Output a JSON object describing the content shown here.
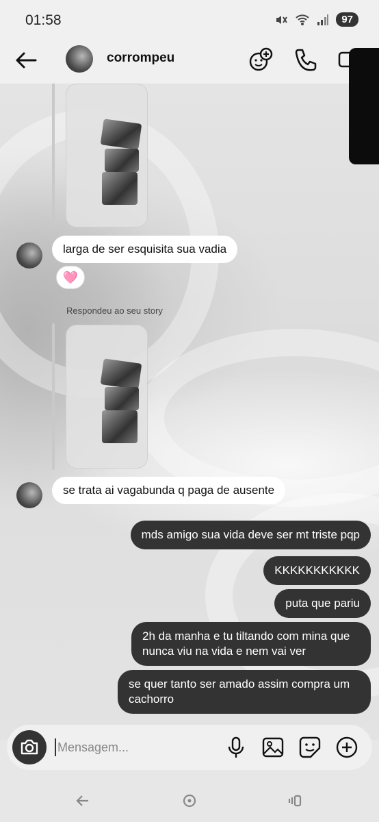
{
  "status_bar": {
    "time": "01:58",
    "battery": "97",
    "icons": [
      "mute-icon",
      "wifi-icon",
      "signal-icon"
    ]
  },
  "header": {
    "contact_name": "corrompeu",
    "icons": [
      "back-arrow-icon",
      "face-add-icon",
      "phone-icon",
      "video-icon"
    ]
  },
  "messages": {
    "incoming_1": "larga de ser esquisita sua vadia",
    "reaction_1": "🩷",
    "reply_caption": "Respondeu ao seu story",
    "incoming_2": "se trata ai vagabunda q paga de ausente",
    "outgoing": [
      "mds amigo sua vida deve ser mt triste pqp",
      "KKKKKKKKKKK",
      "puta que pariu",
      "2h da manha e tu tiltando com mina que nunca viu na vida e nem vai ver",
      "se quer tanto ser amado assim compra um cachorro"
    ]
  },
  "composer": {
    "placeholder": "Mensagem...",
    "icons": [
      "camera-icon",
      "microphone-icon",
      "image-icon",
      "sticker-icon",
      "plus-icon"
    ]
  },
  "nav_bar": {
    "icons": [
      "nav-back-icon",
      "nav-home-icon",
      "nav-recents-icon"
    ]
  },
  "colors": {
    "outgoing_bubble": "#333333",
    "incoming_bubble": "#ffffff",
    "header_bg": "#f0f0f0"
  }
}
